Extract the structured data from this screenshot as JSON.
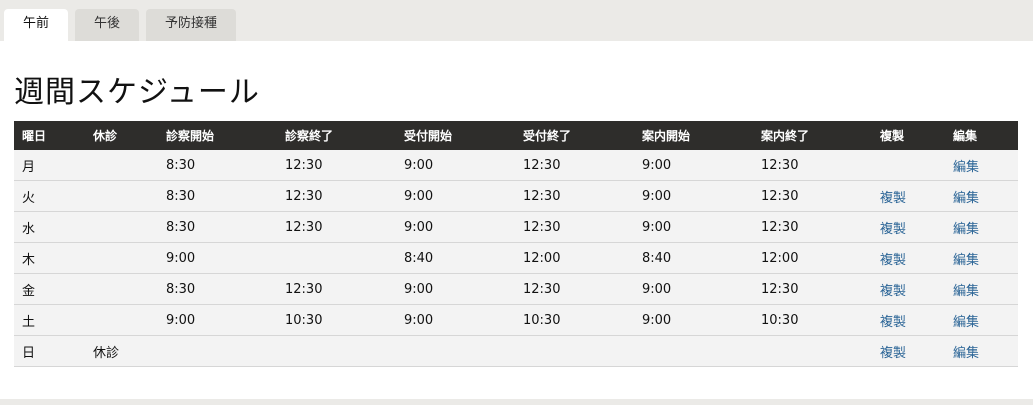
{
  "tabs": [
    {
      "label": "午前",
      "active": true
    },
    {
      "label": "午後",
      "active": false
    },
    {
      "label": "予防接種",
      "active": false
    }
  ],
  "page_title": "週間スケジュール",
  "table": {
    "headers": [
      "曜日",
      "休診",
      "診察開始",
      "診察終了",
      "受付開始",
      "受付終了",
      "案内開始",
      "案内終了",
      "複製",
      "編集"
    ],
    "rows": [
      {
        "day": "月",
        "closed": "",
        "exam_start": "8:30",
        "exam_end": "12:30",
        "reception_start": "9:00",
        "reception_end": "12:30",
        "guide_start": "9:00",
        "guide_end": "12:30",
        "copy": "",
        "edit": "編集"
      },
      {
        "day": "火",
        "closed": "",
        "exam_start": "8:30",
        "exam_end": "12:30",
        "reception_start": "9:00",
        "reception_end": "12:30",
        "guide_start": "9:00",
        "guide_end": "12:30",
        "copy": "複製",
        "edit": "編集"
      },
      {
        "day": "水",
        "closed": "",
        "exam_start": "8:30",
        "exam_end": "12:30",
        "reception_start": "9:00",
        "reception_end": "12:30",
        "guide_start": "9:00",
        "guide_end": "12:30",
        "copy": "複製",
        "edit": "編集"
      },
      {
        "day": "木",
        "closed": "",
        "exam_start": "9:00",
        "exam_end": "",
        "reception_start": "8:40",
        "reception_end": "12:00",
        "guide_start": "8:40",
        "guide_end": "12:00",
        "copy": "複製",
        "edit": "編集"
      },
      {
        "day": "金",
        "closed": "",
        "exam_start": "8:30",
        "exam_end": "12:30",
        "reception_start": "9:00",
        "reception_end": "12:30",
        "guide_start": "9:00",
        "guide_end": "12:30",
        "copy": "複製",
        "edit": "編集"
      },
      {
        "day": "土",
        "closed": "",
        "exam_start": "9:00",
        "exam_end": "10:30",
        "reception_start": "9:00",
        "reception_end": "10:30",
        "guide_start": "9:00",
        "guide_end": "10:30",
        "copy": "複製",
        "edit": "編集"
      },
      {
        "day": "日",
        "closed": "休診",
        "exam_start": "",
        "exam_end": "",
        "reception_start": "",
        "reception_end": "",
        "guide_start": "",
        "guide_end": "",
        "copy": "複製",
        "edit": "編集"
      }
    ]
  },
  "colors": {
    "header_bg": "#2e2d2b",
    "link": "#2a6496",
    "row_bg": "#f3f3f3",
    "page_bg": "#ebeae7"
  }
}
